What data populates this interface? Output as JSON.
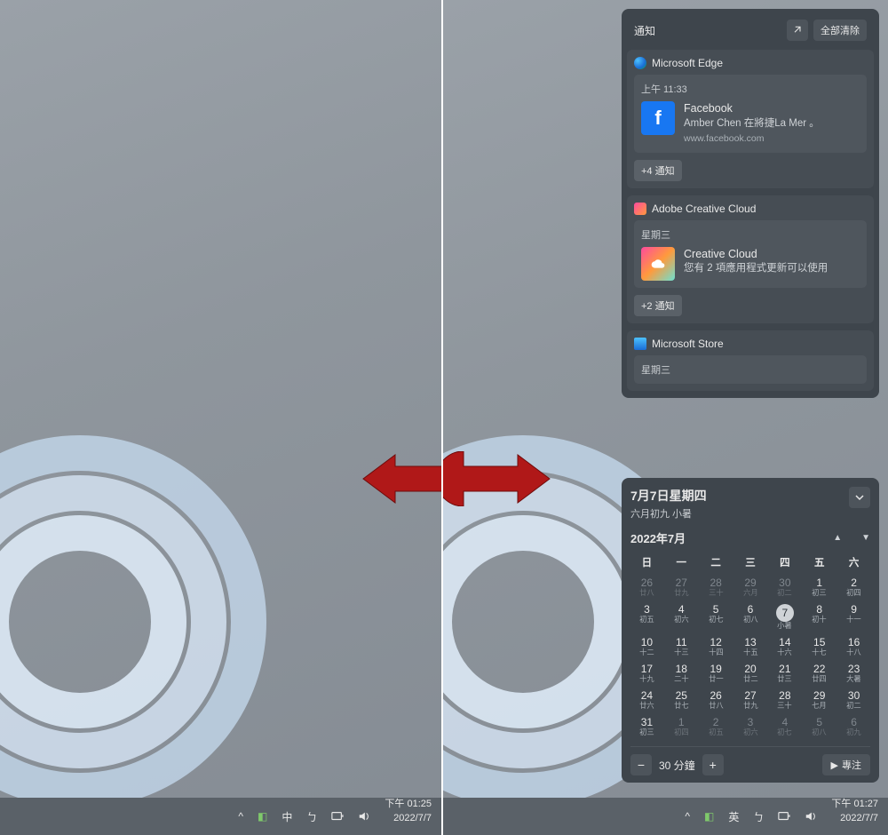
{
  "taskbar_left": {
    "ime": "中",
    "time": "下午 01:25",
    "date": "2022/7/7"
  },
  "taskbar_right": {
    "ime": "英",
    "time": "下午 01:27",
    "date": "2022/7/7"
  },
  "notif": {
    "title": "通知",
    "clear_all": "全部清除",
    "groups": [
      {
        "app": "Microsoft Edge",
        "more": "+4 通知",
        "items": [
          {
            "time": "上午 11:33",
            "title": "Facebook",
            "msg": "Amber Chen 在將捷La Mer 。",
            "src": "www.facebook.com"
          }
        ]
      },
      {
        "app": "Adobe Creative Cloud",
        "more": "+2 通知",
        "items": [
          {
            "time": "星期三",
            "title": "Creative Cloud",
            "msg": "您有 2 項應用程式更新可以使用"
          }
        ]
      },
      {
        "app": "Microsoft Store",
        "more": "",
        "items": [
          {
            "time": "星期三"
          }
        ]
      }
    ]
  },
  "cal": {
    "big": "7月7日星期四",
    "sub": "六月初九 小暑",
    "month": "2022年7月",
    "dow": [
      "日",
      "一",
      "二",
      "三",
      "四",
      "五",
      "六"
    ],
    "days": [
      {
        "n": "26",
        "s": "廿八",
        "dim": true
      },
      {
        "n": "27",
        "s": "廿九",
        "dim": true
      },
      {
        "n": "28",
        "s": "三十",
        "dim": true
      },
      {
        "n": "29",
        "s": "六月",
        "dim": true
      },
      {
        "n": "30",
        "s": "初二",
        "dim": true
      },
      {
        "n": "1",
        "s": "初三"
      },
      {
        "n": "2",
        "s": "初四"
      },
      {
        "n": "3",
        "s": "初五"
      },
      {
        "n": "4",
        "s": "初六"
      },
      {
        "n": "5",
        "s": "初七"
      },
      {
        "n": "6",
        "s": "初八"
      },
      {
        "n": "7",
        "s": "小暑",
        "today": true
      },
      {
        "n": "8",
        "s": "初十"
      },
      {
        "n": "9",
        "s": "十一"
      },
      {
        "n": "10",
        "s": "十二"
      },
      {
        "n": "11",
        "s": "十三"
      },
      {
        "n": "12",
        "s": "十四"
      },
      {
        "n": "13",
        "s": "十五"
      },
      {
        "n": "14",
        "s": "十六"
      },
      {
        "n": "15",
        "s": "十七"
      },
      {
        "n": "16",
        "s": "十八"
      },
      {
        "n": "17",
        "s": "十九"
      },
      {
        "n": "18",
        "s": "二十"
      },
      {
        "n": "19",
        "s": "廿一"
      },
      {
        "n": "20",
        "s": "廿二"
      },
      {
        "n": "21",
        "s": "廿三"
      },
      {
        "n": "22",
        "s": "廿四"
      },
      {
        "n": "23",
        "s": "大暑"
      },
      {
        "n": "24",
        "s": "廿六"
      },
      {
        "n": "25",
        "s": "廿七"
      },
      {
        "n": "26",
        "s": "廿八"
      },
      {
        "n": "27",
        "s": "廿九"
      },
      {
        "n": "28",
        "s": "三十"
      },
      {
        "n": "29",
        "s": "七月"
      },
      {
        "n": "30",
        "s": "初二"
      },
      {
        "n": "31",
        "s": "初三"
      },
      {
        "n": "1",
        "s": "初四",
        "dim": true
      },
      {
        "n": "2",
        "s": "初五",
        "dim": true
      },
      {
        "n": "3",
        "s": "初六",
        "dim": true
      },
      {
        "n": "4",
        "s": "初七",
        "dim": true
      },
      {
        "n": "5",
        "s": "初八",
        "dim": true
      },
      {
        "n": "6",
        "s": "初九",
        "dim": true
      }
    ],
    "focus_duration": "30 分鐘",
    "focus_label": "專注"
  }
}
